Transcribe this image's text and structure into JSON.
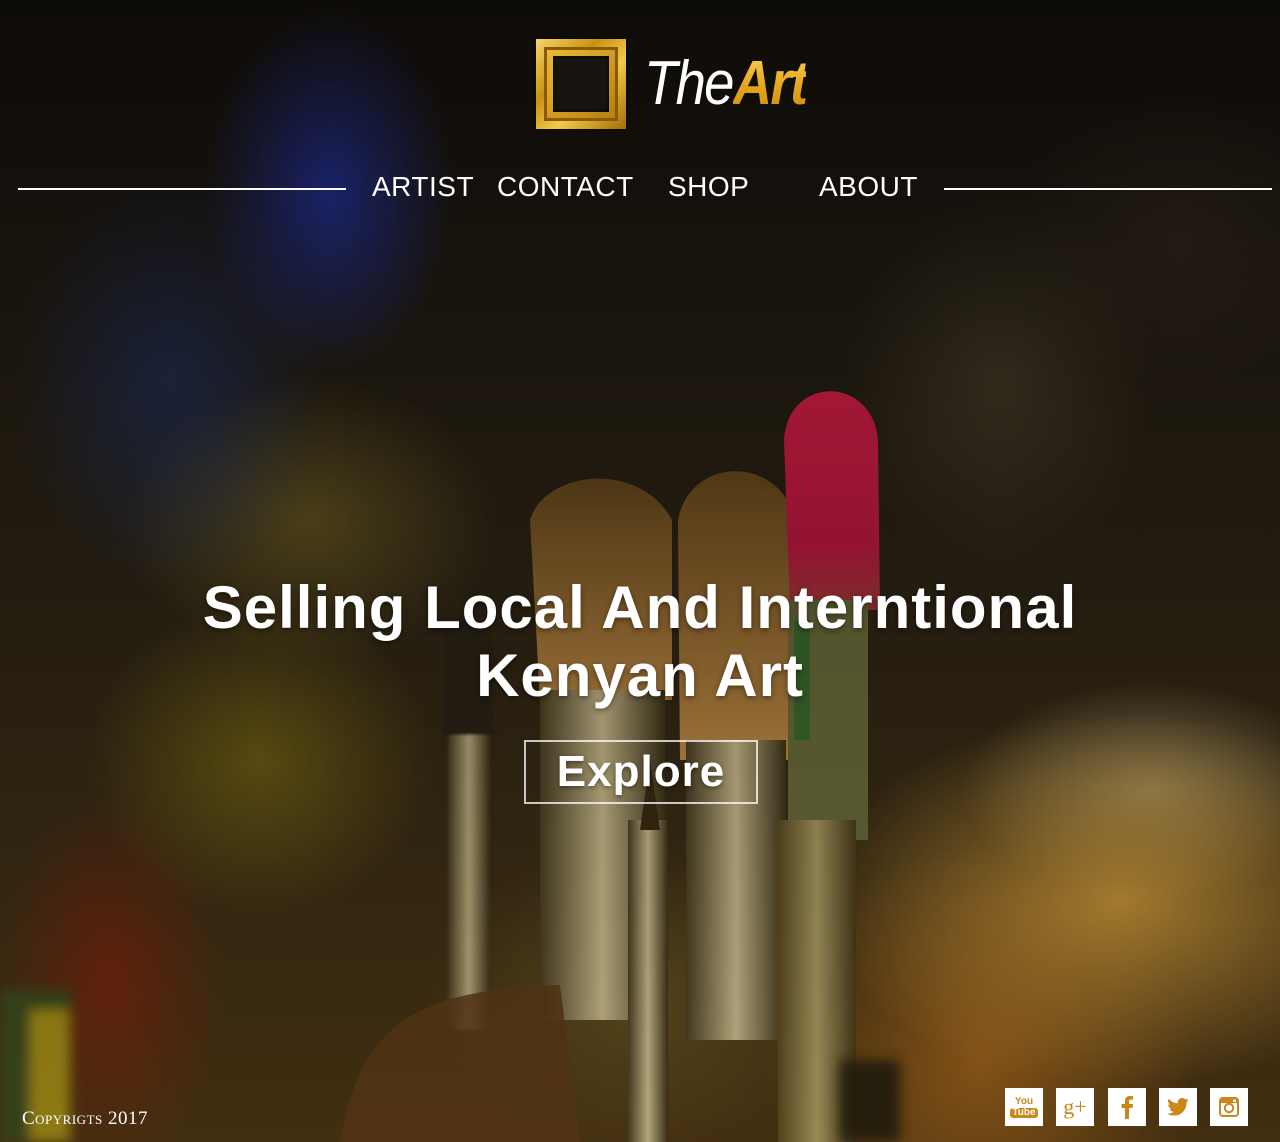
{
  "brand": {
    "the": "The",
    "art": "Art"
  },
  "nav": {
    "items": [
      "ARTIST",
      "CONTACT",
      "SHOP",
      "ABOUT"
    ]
  },
  "hero": {
    "title_line1": "Selling Local And Interntional",
    "title_line2": "Kenyan Art",
    "cta": "Explore"
  },
  "footer": {
    "copyright": "Copyrigts 2017",
    "social": [
      {
        "icon": "youtube-icon",
        "label_top": "You",
        "label_bottom": "Tube"
      },
      {
        "icon": "google-plus-icon",
        "label": "g+"
      },
      {
        "icon": "facebook-icon"
      },
      {
        "icon": "twitter-icon"
      },
      {
        "icon": "instagram-icon"
      }
    ]
  },
  "colors": {
    "accent": "#e4a51c",
    "icon_color": "#c9871c",
    "text": "#ffffff"
  }
}
